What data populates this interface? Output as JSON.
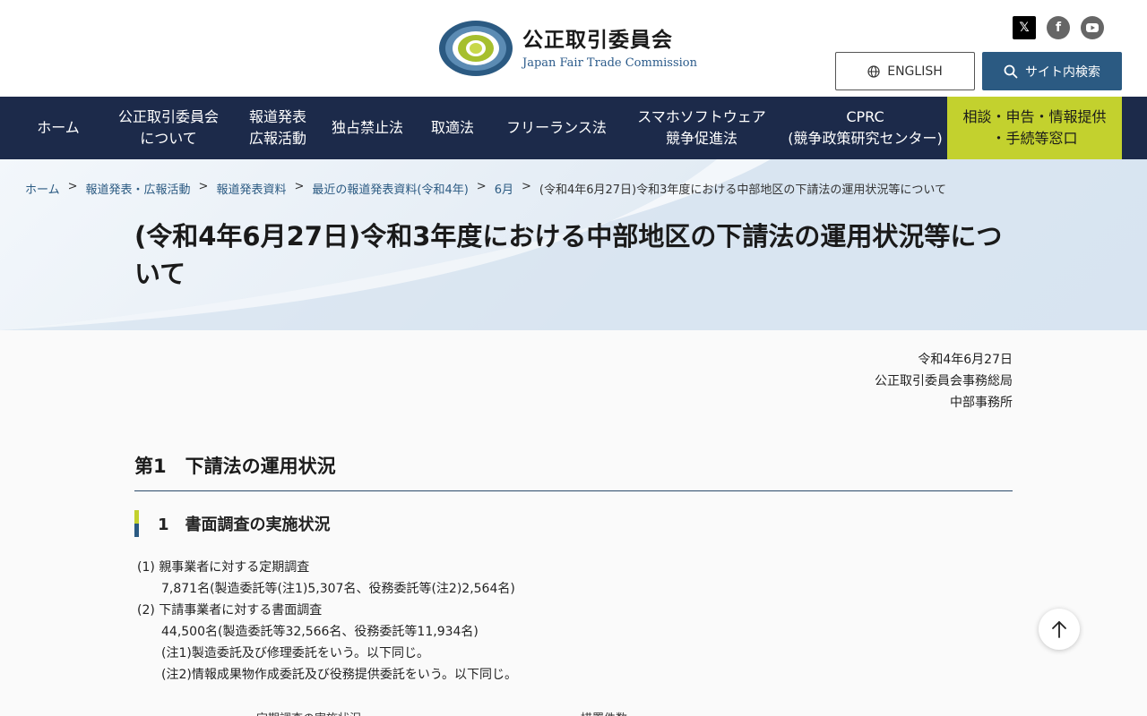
{
  "header": {
    "logo_jp": "公正取引委員会",
    "logo_en": "Japan Fair Trade Commission",
    "english_label": "ENGLISH",
    "search_label": "サイト内検索",
    "social": {
      "x": "𝕏",
      "facebook": "f",
      "youtube": "▶"
    }
  },
  "nav": {
    "items": [
      {
        "line1": "ホーム",
        "line2": ""
      },
      {
        "line1": "公正取引委員会",
        "line2": "について"
      },
      {
        "line1": "報道発表",
        "line2": "広報活動"
      },
      {
        "line1": "独占禁止法",
        "line2": ""
      },
      {
        "line1": "取適法",
        "line2": ""
      },
      {
        "line1": "フリーランス法",
        "line2": ""
      },
      {
        "line1": "スマホソフトウェア",
        "line2": "競争促進法"
      },
      {
        "line1": "CPRC",
        "line2": "(競争政策研究センター)"
      },
      {
        "line1": "相談・申告・情報提供",
        "line2": "・手続等窓口"
      }
    ]
  },
  "breadcrumb": {
    "items": [
      "ホーム",
      "報道発表・広報活動",
      "報道発表資料",
      "最近の報道発表資料(令和4年)",
      "6月"
    ],
    "current": "(令和4年6月27日)令和3年度における中部地区の下請法の運用状況等について",
    "separator": ">"
  },
  "page": {
    "title": "(令和4年6月27日)令和3年度における中部地区の下請法の運用状況等について"
  },
  "meta": {
    "date": "令和4年6月27日",
    "office": "公正取引委員会事務総局",
    "branch": "中部事務所"
  },
  "section": {
    "h2": "第1　下請法の運用状況",
    "h3": "1　書面調査の実施状況",
    "lines": [
      "(1) 親事業者に対する定期調査",
      "7,871名(製造委託等(注1)5,307名、役務委託等(注2)2,564名)",
      "(2) 下請事業者に対する書面調査",
      "44,500名(製造委託等32,566名、役務委託等11,934名)",
      "(注1)製造委託及び修理委託をいう。以下同じ。",
      "(注2)情報成果物作成委託及び役務提供委託をいう。以下同じ。"
    ],
    "table_head_left": "定期調査の実施状況",
    "table_head_right": "措置件数"
  },
  "colors": {
    "navy": "#1c2a4a",
    "accent_lime": "#c3d12e",
    "blue": "#2b5a82"
  }
}
